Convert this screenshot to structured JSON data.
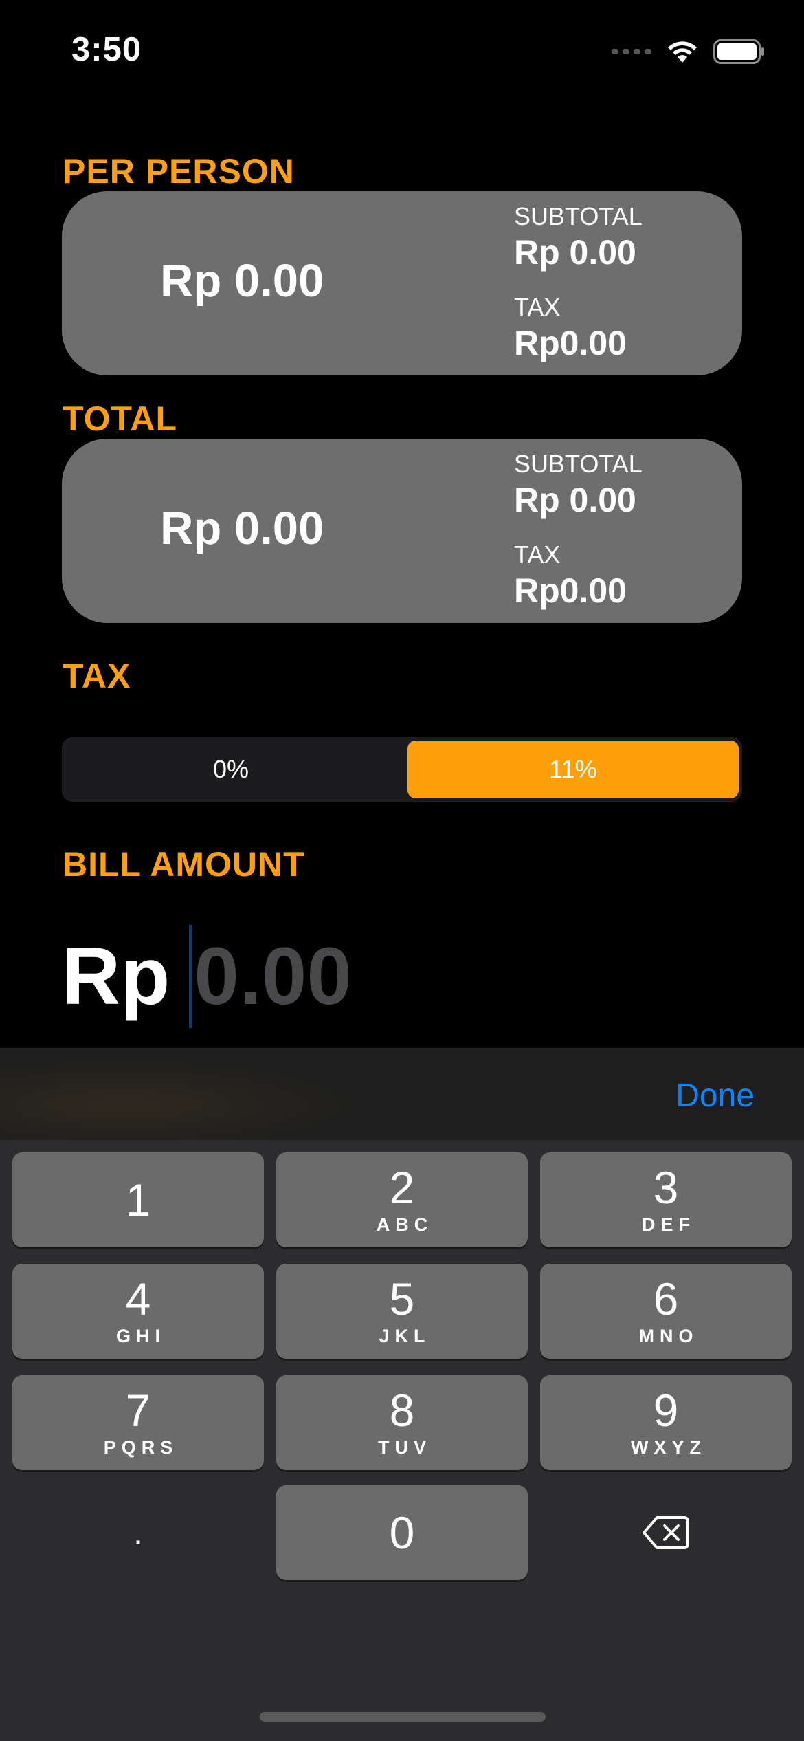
{
  "status": {
    "time": "3:50"
  },
  "per_person": {
    "label": "PER PERSON",
    "amount": "Rp 0.00",
    "subtotal_label": "SUBTOTAL",
    "subtotal_value": "Rp 0.00",
    "tax_label": "TAX",
    "tax_value": "Rp0.00"
  },
  "total": {
    "label": "TOTAL",
    "amount": "Rp 0.00",
    "subtotal_label": "SUBTOTAL",
    "subtotal_value": "Rp 0.00",
    "tax_label": "TAX",
    "tax_value": "Rp0.00"
  },
  "tax": {
    "label": "TAX",
    "options": [
      "0%",
      "11%"
    ],
    "selected": "11%"
  },
  "bill": {
    "label": "BILL AMOUNT",
    "prefix": "Rp",
    "placeholder": "0.00",
    "value": ""
  },
  "keyboard": {
    "done_label": "Done",
    "keys": [
      {
        "num": "1",
        "letters": ""
      },
      {
        "num": "2",
        "letters": "ABC"
      },
      {
        "num": "3",
        "letters": "DEF"
      },
      {
        "num": "4",
        "letters": "GHI"
      },
      {
        "num": "5",
        "letters": "JKL"
      },
      {
        "num": "6",
        "letters": "MNO"
      },
      {
        "num": "7",
        "letters": "PQRS"
      },
      {
        "num": "8",
        "letters": "TUV"
      },
      {
        "num": "9",
        "letters": "WXYZ"
      },
      {
        "num": ".",
        "letters": ""
      },
      {
        "num": "0",
        "letters": ""
      }
    ],
    "delete_icon": "delete-backspace-icon"
  },
  "colors": {
    "accent": "#ff9f0a",
    "card": "#6e6e6e",
    "link": "#0a84ff"
  }
}
